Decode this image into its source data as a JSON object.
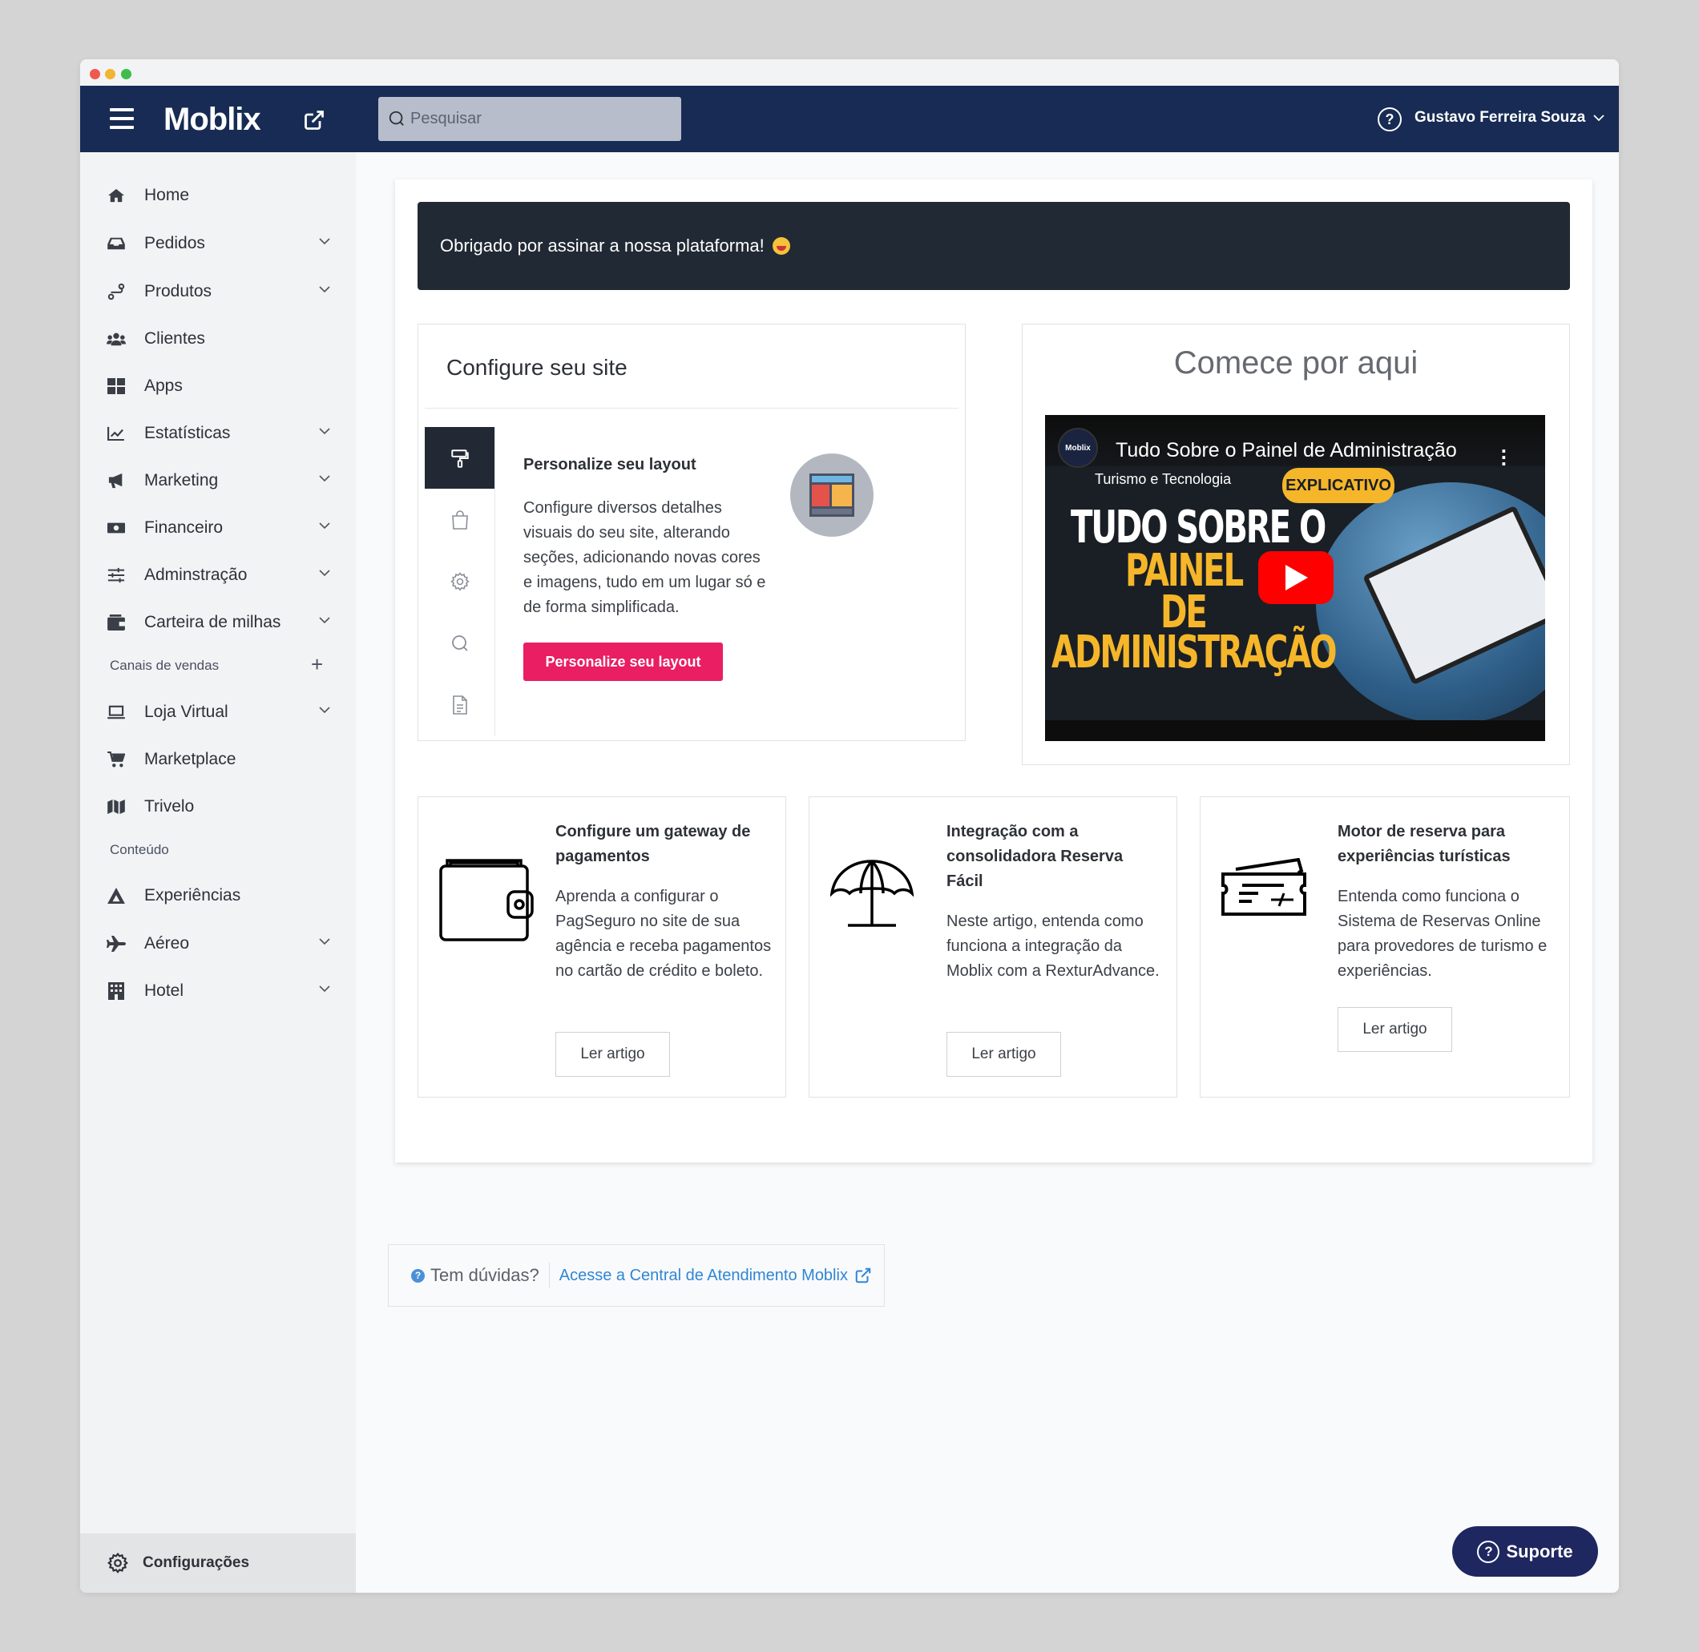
{
  "app": {
    "logo": "Moblix"
  },
  "search": {
    "placeholder": "Pesquisar"
  },
  "user": {
    "name": "Gustavo Ferreira Souza"
  },
  "sidebar": {
    "items": [
      {
        "label": "Home",
        "icon": "home-icon"
      },
      {
        "label": "Pedidos",
        "icon": "inbox-icon"
      },
      {
        "label": "Produtos",
        "icon": "products-icon"
      },
      {
        "label": "Clientes",
        "icon": "users-icon"
      },
      {
        "label": "Apps",
        "icon": "grid-icon"
      },
      {
        "label": "Estatísticas",
        "icon": "chart-icon"
      },
      {
        "label": "Marketing",
        "icon": "megaphone-icon"
      },
      {
        "label": "Financeiro",
        "icon": "money-icon"
      },
      {
        "label": "Adminstração",
        "icon": "sliders-icon"
      },
      {
        "label": "Carteira de milhas",
        "icon": "wallet-icon"
      }
    ],
    "sales_section": "Canais de vendas",
    "sales_items": [
      {
        "label": "Loja Virtual",
        "icon": "laptop-icon"
      },
      {
        "label": "Marketplace",
        "icon": "cart-icon"
      },
      {
        "label": "Trivelo",
        "icon": "map-icon"
      }
    ],
    "content_section": "Conteúdo",
    "content_items": [
      {
        "label": "Experiências",
        "icon": "hiking-icon"
      },
      {
        "label": "Aéreo",
        "icon": "plane-icon"
      },
      {
        "label": "Hotel",
        "icon": "hotel-icon"
      }
    ],
    "config_label": "Configurações"
  },
  "banner": {
    "text": "Obrigado por assinar a nossa plataforma!"
  },
  "site_config": {
    "title": "Configure seu site",
    "heading": "Personalize seu layout",
    "description": "Configure diversos detalhes visuais do seu site, alterando seções, adicionando novas cores e imagens, tudo em um lugar só e de forma simplificada.",
    "button": "Personalize seu layout"
  },
  "start": {
    "title": "Comece por aqui",
    "video": {
      "channel_logo": "Moblix",
      "title": "Tudo Sobre o Painel de Administração",
      "subtitle": "Turismo e Tecnologia",
      "tag": "EXPLICATIVO",
      "line1": "TUDO SOBRE O",
      "line2": "PAINEL",
      "line3": "DE",
      "line4": "ADMINISTRAÇÃO"
    }
  },
  "articles": [
    {
      "title": "Configure um gateway de pagamentos",
      "text": "Aprenda a configurar o PagSeguro no site de sua agência e receba pagamentos no cartão de crédito e boleto.",
      "button": "Ler artigo",
      "icon": "wallet-icon"
    },
    {
      "title": "Integração com a consolidadora Reserva Fácil",
      "text": "Neste artigo, entenda como funciona a integração da Moblix com a RexturAdvance.",
      "button": "Ler artigo",
      "icon": "beach-umbrella-icon"
    },
    {
      "title": "Motor de reserva para experiências turísticas",
      "text": "Entenda como funciona o Sistema de Reservas Online para provedores de turismo e experiências.",
      "button": "Ler artigo",
      "icon": "ticket-icon"
    }
  ],
  "help": {
    "question": "Tem dúvidas?",
    "link": "Acesse a Central de Atendimento Moblix"
  },
  "support_button": "Suporte",
  "colors": {
    "topbar": "#172b54",
    "accent": "#e91e63",
    "support": "#1f2760"
  }
}
